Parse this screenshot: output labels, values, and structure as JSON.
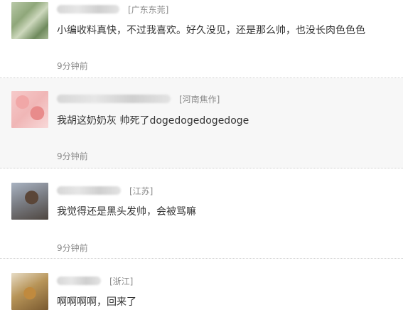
{
  "comments": [
    {
      "location": "[广东东莞]",
      "text": "小编收料真快，不过我喜欢。好久没见，还是那么帅，也没长肉色色色",
      "time": "9分钟前"
    },
    {
      "location": "[河南焦作]",
      "text": "我胡这奶奶灰 帅死了dogedogedogedoge",
      "time": "9分钟前"
    },
    {
      "location": "[江苏]",
      "text": "我觉得还是黑头发帅，会被骂嘛",
      "time": "9分钟前"
    },
    {
      "location": "[浙江]",
      "text": "啊啊啊啊，回来了",
      "time": ""
    }
  ]
}
